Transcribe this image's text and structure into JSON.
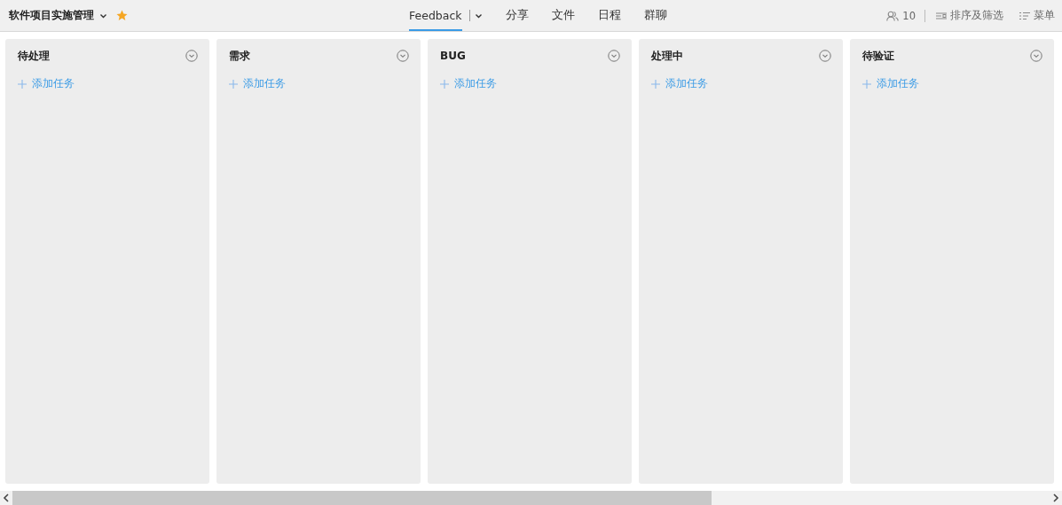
{
  "project": {
    "title": "软件项目实施管理",
    "starred": true
  },
  "tabs": [
    {
      "label": "Feedback",
      "selected": true,
      "dropdown": true
    },
    {
      "label": "分享",
      "selected": false
    },
    {
      "label": "文件",
      "selected": false
    },
    {
      "label": "日程",
      "selected": false
    },
    {
      "label": "群聊",
      "selected": false
    }
  ],
  "toolbar": {
    "members": "10",
    "sort_filter": "排序及筛选",
    "menu": "菜单"
  },
  "columns": [
    {
      "title": "待处理",
      "add_task": "添加任务"
    },
    {
      "title": "需求",
      "add_task": "添加任务"
    },
    {
      "title": "BUG",
      "add_task": "添加任务"
    },
    {
      "title": "处理中",
      "add_task": "添加任务"
    },
    {
      "title": "待验证",
      "add_task": "添加任务"
    }
  ]
}
